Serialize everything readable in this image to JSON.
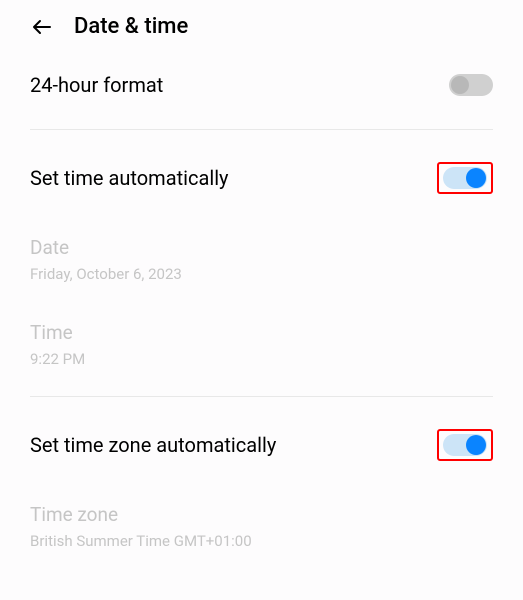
{
  "header": {
    "title": "Date & time"
  },
  "settings": {
    "clock_format": {
      "label": "24-hour format",
      "enabled": false
    },
    "auto_time": {
      "label": "Set time automatically",
      "enabled": true
    },
    "date": {
      "label": "Date",
      "value": "Friday, October 6, 2023"
    },
    "time": {
      "label": "Time",
      "value": "9:22 PM"
    },
    "auto_timezone": {
      "label": "Set time zone automatically",
      "enabled": true
    },
    "timezone": {
      "label": "Time zone",
      "value": "British Summer Time GMT+01:00"
    }
  }
}
